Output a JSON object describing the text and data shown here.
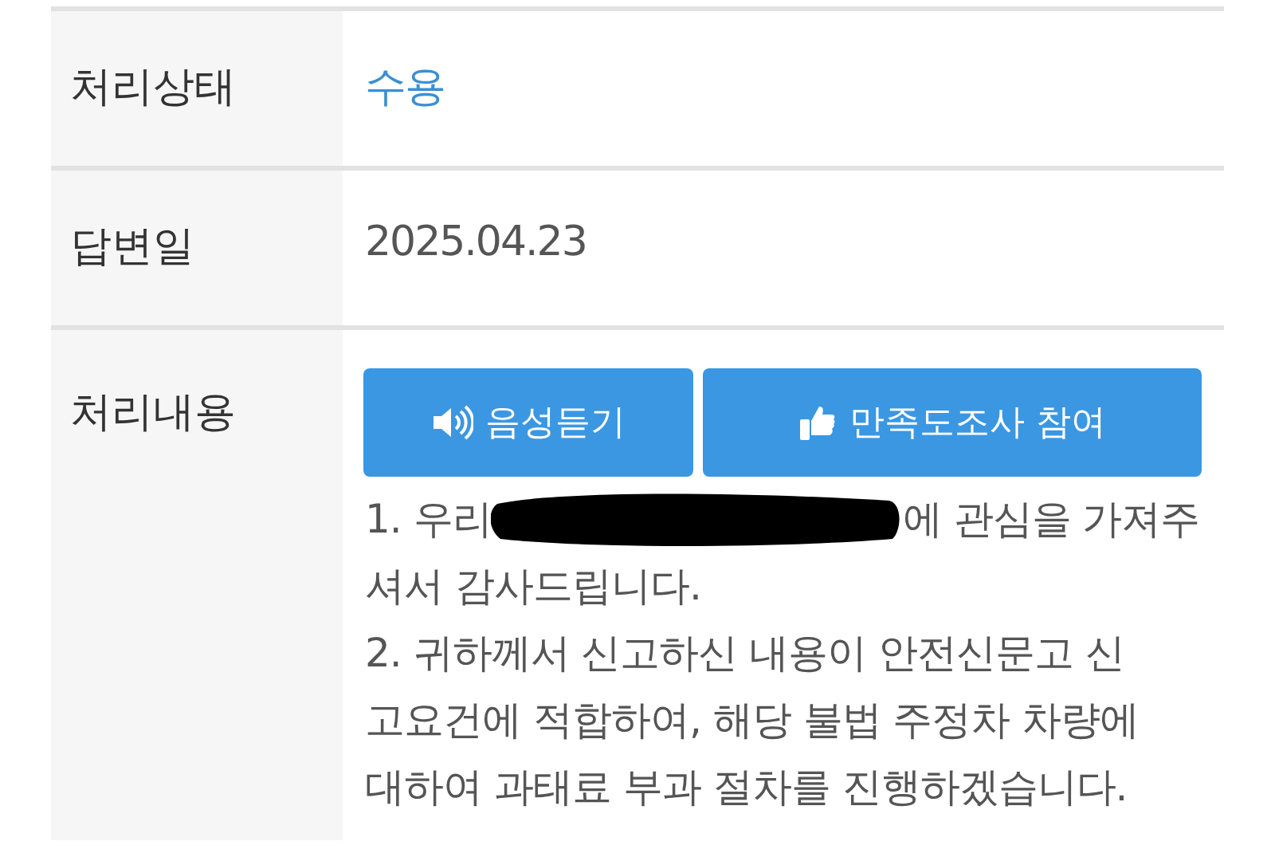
{
  "rows": [
    {
      "label": "처리상태",
      "kind": "status",
      "value": "수용"
    },
    {
      "label": "답변일",
      "kind": "text",
      "value": "2025.04.23"
    },
    {
      "label": "처리내용",
      "kind": "content",
      "buttons": [
        {
          "label": "음성듣기",
          "kind": "audio"
        },
        {
          "label": "만족도조사 참여",
          "kind": "survey"
        }
      ],
      "first_line": {
        "before": "1. 우리",
        "after": "에 관심을 가져주"
      },
      "lines": [
        "셔서 감사드립니다.",
        "2. 귀하께서 신고하신 내용이 안전신문고 신",
        "고요건에 적합하여, 해당 불법 주정차 차량에",
        "대하여 과태료 부과 절차를 진행하겠습니다."
      ]
    }
  ]
}
